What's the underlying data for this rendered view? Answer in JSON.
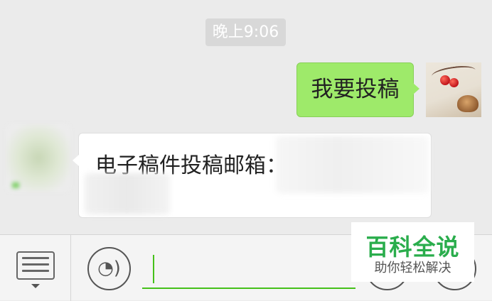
{
  "chat": {
    "timestamp": "晚上9:06",
    "messages": [
      {
        "side": "sent",
        "text": "我要投稿"
      },
      {
        "side": "received",
        "text": "电子稿件投稿邮箱："
      }
    ]
  },
  "toolbar": {
    "menu_icon": "list-menu-icon",
    "voice_icon": "voice-icon",
    "voice_glyph": "◔)",
    "input_value": ""
  },
  "watermark": {
    "title": "百科全说",
    "subtitle": "助你轻松解决"
  },
  "colors": {
    "sent_bubble": "#9eea6a",
    "accent_green": "#45c01a",
    "watermark_green": "#2aad4c"
  }
}
